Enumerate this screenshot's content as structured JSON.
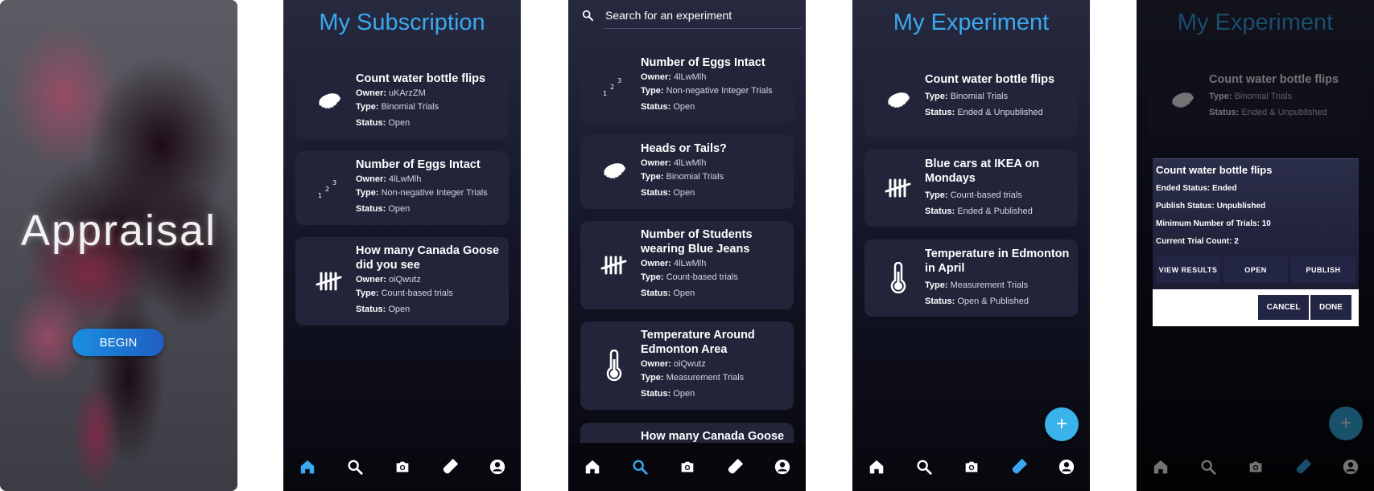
{
  "splash": {
    "title": "Appraisal",
    "begin_label": "BEGIN"
  },
  "subscription": {
    "header": "My Subscription",
    "cards": [
      {
        "icon": "coin-icon",
        "title": "Count water bottle flips",
        "owner_label": "Owner:",
        "owner": "uKArzZM",
        "type_label": "Type:",
        "type": "Binomial Trials",
        "status_label": "Status:",
        "status": "Open"
      },
      {
        "icon": "numbers-icon",
        "title": "Number of Eggs Intact",
        "owner_label": "Owner:",
        "owner": "4lLwMlh",
        "type_label": "Type:",
        "type": "Non-negative Integer Trials",
        "status_label": "Status:",
        "status": "Open"
      },
      {
        "icon": "tally-icon",
        "title": "How many Canada Goose did you see",
        "owner_label": "Owner:",
        "owner": "oiQwutz",
        "type_label": "Type:",
        "type": "Count-based trials",
        "status_label": "Status:",
        "status": "Open"
      }
    ]
  },
  "search": {
    "placeholder": "Search for an experiment",
    "cards": [
      {
        "icon": "numbers-icon",
        "title": "Number of Eggs Intact",
        "owner_label": "Owner:",
        "owner": "4lLwMlh",
        "type_label": "Type:",
        "type": "Non-negative Integer Trials",
        "status_label": "Status:",
        "status": "Open"
      },
      {
        "icon": "coin-icon",
        "title": "Heads or Tails?",
        "owner_label": "Owner:",
        "owner": "4lLwMlh",
        "type_label": "Type:",
        "type": "Binomial Trials",
        "status_label": "Status:",
        "status": "Open"
      },
      {
        "icon": "tally-icon",
        "title": "Number of Students wearing Blue Jeans",
        "owner_label": "Owner:",
        "owner": "4lLwMlh",
        "type_label": "Type:",
        "type": "Count-based trials",
        "status_label": "Status:",
        "status": "Open"
      },
      {
        "icon": "thermometer-icon",
        "title": "Temperature Around Edmonton Area",
        "owner_label": "Owner:",
        "owner": "oiQwutz",
        "type_label": "Type:",
        "type": "Measurement Trials",
        "status_label": "Status:",
        "status": "Open"
      },
      {
        "title": "How many Canada Goose"
      }
    ]
  },
  "experiment": {
    "header": "My Experiment",
    "cards": [
      {
        "icon": "coin-icon",
        "title": "Count water bottle flips",
        "type_label": "Type:",
        "type": "Binomial Trials",
        "status_label": "Status:",
        "status": "Ended & Unpublished"
      },
      {
        "icon": "tally-icon",
        "title": "Blue cars at IKEA on Mondays",
        "type_label": "Type:",
        "type": "Count-based trials",
        "status_label": "Status:",
        "status": "Ended & Published"
      },
      {
        "icon": "thermometer-icon",
        "title": "Temperature in Edmonton in April",
        "type_label": "Type:",
        "type": "Measurement Trials",
        "status_label": "Status:",
        "status": "Open & Published"
      }
    ],
    "fab_label": "+"
  },
  "dialog": {
    "title": "Count water bottle flips",
    "ended_label": "Ended Status:",
    "ended": "Ended",
    "publish_label": "Publish Status:",
    "publish": "Unpublished",
    "min_label": "Minimum Number of Trials:",
    "min": "10",
    "count_label": "Current Trial Count:",
    "count": "2",
    "view_results": "VIEW RESULTS",
    "open": "OPEN",
    "publish_btn": "PUBLISH",
    "cancel": "CANCEL",
    "done": "DONE"
  },
  "nav": {
    "items": [
      "home-icon",
      "search-icon",
      "camera-icon",
      "flask-icon",
      "profile-icon"
    ]
  },
  "colors": {
    "accent": "#3aa8f0",
    "card": "#22243a",
    "nav_inactive": "#ffffff"
  }
}
